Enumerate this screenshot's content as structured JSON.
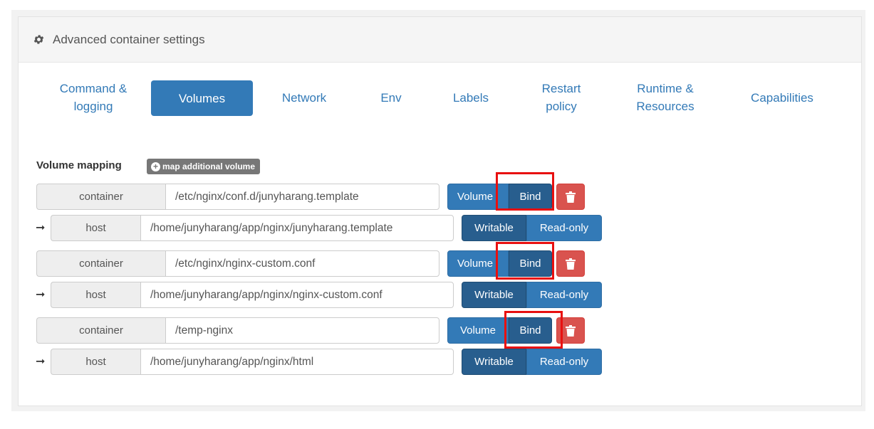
{
  "panel": {
    "title": "Advanced container settings",
    "icon": "gear-icon"
  },
  "tabs": [
    {
      "label": "Command & logging",
      "lines": [
        "Command &",
        "logging"
      ],
      "active": false
    },
    {
      "label": "Volumes",
      "lines": [
        "Volumes"
      ],
      "active": true
    },
    {
      "label": "Network",
      "lines": [
        "Network"
      ],
      "active": false
    },
    {
      "label": "Env",
      "lines": [
        "Env"
      ],
      "active": false
    },
    {
      "label": "Labels",
      "lines": [
        "Labels"
      ],
      "active": false
    },
    {
      "label": "Restart policy",
      "lines": [
        "Restart",
        "policy"
      ],
      "active": false
    },
    {
      "label": "Runtime & Resources",
      "lines": [
        "Runtime &",
        "Resources"
      ],
      "active": false
    },
    {
      "label": "Capabilities",
      "lines": [
        "Capabilities"
      ],
      "active": false
    }
  ],
  "volumes": {
    "heading": "Volume mapping",
    "add_label": "map additional volume",
    "container_label": "container",
    "host_label": "host",
    "type_volume_label": "Volume",
    "type_bind_label": "Bind",
    "writable_label": "Writable",
    "readonly_label": "Read-only",
    "arrow": "➞",
    "mappings": [
      {
        "container": "/etc/nginx/conf.d/junyharang.template",
        "host": "/home/junyharang/app/nginx/junyharang.template",
        "type": "Bind",
        "mode": "Writable"
      },
      {
        "container": "/etc/nginx/nginx-custom.conf",
        "host": "/home/junyharang/app/nginx/nginx-custom.conf",
        "type": "Bind",
        "mode": "Writable"
      },
      {
        "container": "/temp-nginx",
        "host": "/home/junyharang/app/nginx/html",
        "type": "Bind",
        "mode": "Writable"
      }
    ]
  },
  "colors": {
    "primary": "#337ab7",
    "primary_dark": "#285e8e",
    "danger": "#d9534f",
    "highlight": "#e81010"
  }
}
